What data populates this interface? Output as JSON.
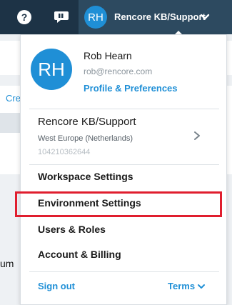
{
  "header": {
    "help_icon": "question-circle-icon",
    "feedback_icon": "speech-bubble-icon",
    "account": {
      "initials": "RH",
      "tenant": "Rencore KB/Support",
      "chevron": "chevron-down-icon"
    }
  },
  "background": {
    "link_fragment": "Cre",
    "text_fragment": "um"
  },
  "dropdown": {
    "user": {
      "initials": "RH",
      "name": "Rob Hearn",
      "email": "rob@rencore.com",
      "profile_link": "Profile & Preferences"
    },
    "tenant": {
      "name": "Rencore KB/Support",
      "region": "West Europe (Netherlands)",
      "id": "104210362644",
      "chevron": "chevron-right-icon"
    },
    "menu_items": [
      {
        "label": "Workspace Settings"
      },
      {
        "label": "Environment Settings",
        "highlighted": true
      },
      {
        "label": "Users & Roles"
      },
      {
        "label": "Account & Billing"
      }
    ],
    "footer": {
      "sign_out": "Sign out",
      "terms": "Terms"
    }
  },
  "colors": {
    "topbar": "#1d3346",
    "accent": "#1f8fd6",
    "highlight_border": "#e01e2e"
  }
}
